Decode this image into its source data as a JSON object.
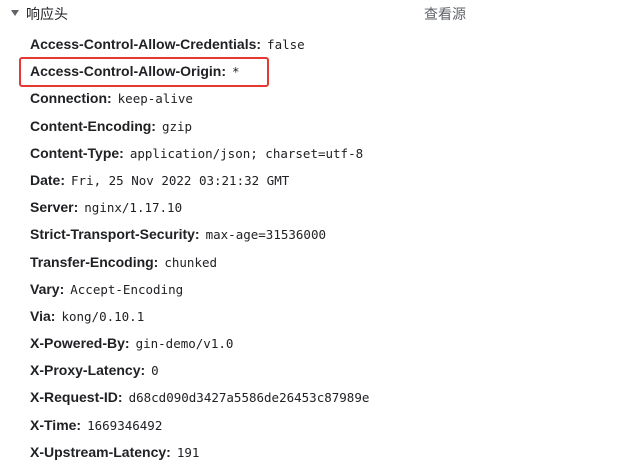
{
  "section": {
    "title": "响应头",
    "view_source_label": "查看源",
    "expanded_icon": "caret-down-icon"
  },
  "headers": [
    {
      "name": "Access-Control-Allow-Credentials:",
      "value": "false"
    },
    {
      "name": "Access-Control-Allow-Origin:",
      "value": "*"
    },
    {
      "name": "Connection:",
      "value": "keep-alive"
    },
    {
      "name": "Content-Encoding:",
      "value": "gzip"
    },
    {
      "name": "Content-Type:",
      "value": "application/json; charset=utf-8"
    },
    {
      "name": "Date:",
      "value": "Fri, 25 Nov 2022 03:21:32 GMT"
    },
    {
      "name": "Server:",
      "value": "nginx/1.17.10"
    },
    {
      "name": "Strict-Transport-Security:",
      "value": "max-age=31536000"
    },
    {
      "name": "Transfer-Encoding:",
      "value": "chunked"
    },
    {
      "name": "Vary:",
      "value": "Accept-Encoding"
    },
    {
      "name": "Via:",
      "value": "kong/0.10.1"
    },
    {
      "name": "X-Powered-By:",
      "value": "gin-demo/v1.0"
    },
    {
      "name": "X-Proxy-Latency:",
      "value": "0"
    },
    {
      "name": "X-Request-ID:",
      "value": "d68cd090d3427a5586de26453c87989e"
    },
    {
      "name": "X-Time:",
      "value": "1669346492"
    },
    {
      "name": "X-Upstream-Latency:",
      "value": "191"
    }
  ],
  "highlight": {
    "color": "#e53935",
    "target_header": "Access-Control-Allow-Origin:"
  }
}
